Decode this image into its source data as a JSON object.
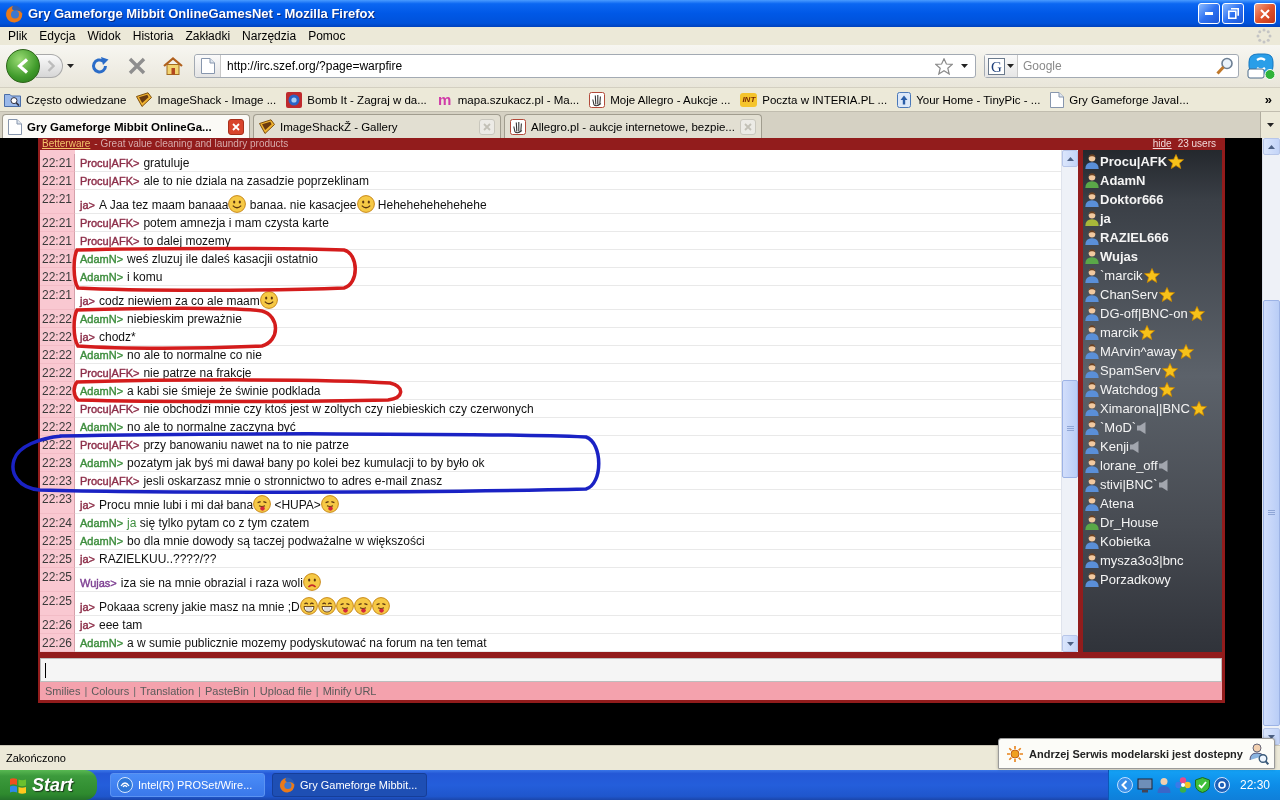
{
  "window": {
    "title": "Gry Gameforge Mibbit OnlineGamesNet - Mozilla Firefox"
  },
  "menu": [
    "Plik",
    "Edycja",
    "Widok",
    "Historia",
    "Zakładki",
    "Narzędzia",
    "Pomoc"
  ],
  "navigation": {
    "url": "http://irc.szef.org/?page=warpfire",
    "search_engine": "G",
    "search_placeholder": "Google"
  },
  "bookmarks": {
    "items": [
      {
        "kind": "folder",
        "label": "Często odwiedzane"
      },
      {
        "kind": "wedge",
        "label": "ImageShack - Image ..."
      },
      {
        "kind": "target",
        "label": "Bomb It - Zagraj w da..."
      },
      {
        "kind": "letter",
        "badge": "m",
        "label": "mapa.szukacz.pl - Ma..."
      },
      {
        "kind": "hand",
        "label": "Moje Allegro - Aukcje ..."
      },
      {
        "kind": "tag",
        "badge": "INT",
        "label": "Poczta w INTERIA.PL ..."
      },
      {
        "kind": "card",
        "label": "Your Home - TinyPic - ..."
      },
      {
        "kind": "page",
        "label": "Gry Gameforge JavaI..."
      }
    ],
    "overflow": "»"
  },
  "tabs": [
    {
      "kind": "page",
      "label": "Gry Gameforge Mibbit OnlineGa...",
      "selected": true
    },
    {
      "kind": "wedge",
      "label": "ImageShackŽ - Gallery",
      "selected": false
    },
    {
      "kind": "hand",
      "label": "Allegro.pl - aukcje internetowe, bezpie...",
      "selected": false
    }
  ],
  "chat": {
    "ad": {
      "link": "Betterware",
      "text": "- Great value cleaning and laundry products"
    },
    "hide_link": "hide",
    "user_count": "23 users",
    "messages": [
      {
        "time": "22:21",
        "nick": "Procu|AFK>",
        "color": "#8c2d48",
        "parts": [
          {
            "kind": "text",
            "text": "gratuluje"
          }
        ]
      },
      {
        "time": "22:21",
        "nick": "Procu|AFK>",
        "color": "#8c2d48",
        "parts": [
          {
            "kind": "text",
            "text": "ale to nie dziala na zasadzie poprzeklinam"
          }
        ]
      },
      {
        "time": "22:21",
        "nick": "ja>",
        "color": "#8c2d48",
        "parts": [
          {
            "kind": "text",
            "text": "A Jaa tez maam banaaa"
          },
          {
            "kind": "smile"
          },
          {
            "kind": "text",
            "text": " banaa. nie kasacjee"
          },
          {
            "kind": "smile"
          },
          {
            "kind": "text",
            "text": " Hehehehehehehehe"
          }
        ]
      },
      {
        "time": "22:21",
        "nick": "Procu|AFK>",
        "color": "#8c2d48",
        "parts": [
          {
            "kind": "text",
            "text": "potem amnezja i mam czysta karte"
          }
        ]
      },
      {
        "time": "22:21",
        "nick": "Procu|AFK>",
        "color": "#8c2d48",
        "parts": [
          {
            "kind": "text",
            "text": "to dalej mozemy"
          }
        ]
      },
      {
        "time": "22:21",
        "nick": "AdamN>",
        "color": "#3e8e3e",
        "parts": [
          {
            "kind": "text",
            "text": "weś zluzuj ile daleś kasacjii ostatnio"
          }
        ]
      },
      {
        "time": "22:21",
        "nick": "AdamN>",
        "color": "#3e8e3e",
        "parts": [
          {
            "kind": "text",
            "text": "i komu"
          }
        ]
      },
      {
        "time": "22:21",
        "nick": "ja>",
        "color": "#8c2d48",
        "parts": [
          {
            "kind": "text",
            "text": "codz niewiem za co ale maam"
          },
          {
            "kind": "smile"
          }
        ]
      },
      {
        "time": "22:22",
        "nick": "AdamN>",
        "color": "#3e8e3e",
        "parts": [
          {
            "kind": "text",
            "text": "niebieskim preważnie"
          }
        ]
      },
      {
        "time": "22:22",
        "nick": "ja>",
        "color": "#8c2d48",
        "parts": [
          {
            "kind": "text",
            "text": "chodz*"
          }
        ]
      },
      {
        "time": "22:22",
        "nick": "AdamN>",
        "color": "#3e8e3e",
        "parts": [
          {
            "kind": "text",
            "text": "no ale to normalne co nie"
          }
        ]
      },
      {
        "time": "22:22",
        "nick": "Procu|AFK>",
        "color": "#8c2d48",
        "parts": [
          {
            "kind": "text",
            "text": "nie patrze na frakcje"
          }
        ]
      },
      {
        "time": "22:22",
        "nick": "AdamN>",
        "color": "#3e8e3e",
        "parts": [
          {
            "kind": "text",
            "text": "a kabi sie śmieje że świnie podklada"
          }
        ]
      },
      {
        "time": "22:22",
        "nick": "Procu|AFK>",
        "color": "#8c2d48",
        "parts": [
          {
            "kind": "text",
            "text": "nie obchodzi mnie czy ktoś jest w zoltych czy niebieskich czy czerwonych"
          }
        ]
      },
      {
        "time": "22:22",
        "nick": "AdamN>",
        "color": "#3e8e3e",
        "parts": [
          {
            "kind": "text",
            "text": "no ale to normalne zaczyna być"
          }
        ]
      },
      {
        "time": "22:22",
        "nick": "Procu|AFK>",
        "color": "#8c2d48",
        "parts": [
          {
            "kind": "text",
            "text": "przy banowaniu nawet na to nie patrze"
          }
        ]
      },
      {
        "time": "22:23",
        "nick": "AdamN>",
        "color": "#3e8e3e",
        "parts": [
          {
            "kind": "text",
            "text": "pozatym jak byś mi dawał bany po kolei bez kumulacji to by było ok"
          }
        ]
      },
      {
        "time": "22:23",
        "nick": "Procu|AFK>",
        "color": "#8c2d48",
        "parts": [
          {
            "kind": "text",
            "text": "jesli oskarzasz mnie o stronnictwo to adres e-mail znasz"
          }
        ]
      },
      {
        "time": "22:23",
        "nick": "ja>",
        "color": "#8c2d48",
        "parts": [
          {
            "kind": "text",
            "text": "Procu mnie lubi i mi dał bana"
          },
          {
            "kind": "tongue"
          },
          {
            "kind": "text",
            "text": " <HUPA>"
          },
          {
            "kind": "tongue"
          }
        ]
      },
      {
        "time": "22:24",
        "nick": "AdamN>",
        "color": "#3e8e3e",
        "parts": [
          {
            "kind": "mention",
            "text": "ja"
          },
          {
            "kind": "text",
            "text": " się tylko pytam co z tym czatem"
          }
        ]
      },
      {
        "time": "22:25",
        "nick": "AdamN>",
        "color": "#3e8e3e",
        "parts": [
          {
            "kind": "text",
            "text": "bo dla mnie dowody są taczej podważalne w większości"
          }
        ]
      },
      {
        "time": "22:25",
        "nick": "ja>",
        "color": "#8c2d48",
        "parts": [
          {
            "kind": "text",
            "text": "RAZIELKUU..????/??"
          }
        ]
      },
      {
        "time": "22:25",
        "nick": "Wujas>",
        "color": "#7d3f92",
        "parts": [
          {
            "kind": "text",
            "text": "iza sie na mnie obrazial i raza woli"
          },
          {
            "kind": "sad"
          }
        ]
      },
      {
        "time": "22:25",
        "nick": "ja>",
        "color": "#8c2d48",
        "parts": [
          {
            "kind": "text",
            "text": "Pokaaa screny jakie masz na mnie ;D"
          },
          {
            "kind": "grin"
          },
          {
            "kind": "grin"
          },
          {
            "kind": "tongue"
          },
          {
            "kind": "tongue"
          },
          {
            "kind": "tongue"
          }
        ]
      },
      {
        "time": "22:26",
        "nick": "ja>",
        "color": "#8c2d48",
        "parts": [
          {
            "kind": "text",
            "text": "eee tam"
          }
        ]
      },
      {
        "time": "22:26",
        "nick": "AdamN>",
        "color": "#3e8e3e",
        "parts": [
          {
            "kind": "text",
            "text": "a w sumie publicznie mozemy podyskutować na forum na ten temat"
          }
        ]
      }
    ],
    "links": [
      {
        "label": "Smilies"
      },
      {
        "label": "Colours"
      },
      {
        "label": "Translation"
      },
      {
        "label": "PasteBin"
      },
      {
        "label": "Upload file"
      },
      {
        "label": "Minify URL"
      }
    ],
    "separator": "|"
  },
  "users": [
    {
      "name": "Procu|AFK",
      "kind": "op",
      "highlighted": true,
      "color": "#5a8fd8"
    },
    {
      "name": "AdamN",
      "kind": "regular",
      "highlighted": true,
      "color": "#5aa848"
    },
    {
      "name": "Doktor666",
      "kind": "regular",
      "highlighted": true,
      "color": "#5a8fd8"
    },
    {
      "name": "ja",
      "kind": "regular",
      "highlighted": true,
      "color": "#a8b83a"
    },
    {
      "name": "RAZIEL666",
      "kind": "regular",
      "highlighted": true,
      "color": "#5a8fd8"
    },
    {
      "name": "Wujas",
      "kind": "regular",
      "highlighted": true,
      "color": "#5aa848"
    },
    {
      "name": "`marcik",
      "kind": "op",
      "highlighted": false,
      "color": "#5a8fd8"
    },
    {
      "name": "ChanServ",
      "kind": "op",
      "highlighted": false,
      "color": "#5a8fd8"
    },
    {
      "name": "DG-off|BNC-on",
      "kind": "op",
      "highlighted": false,
      "color": "#5a8fd8"
    },
    {
      "name": "marcik",
      "kind": "op",
      "highlighted": false,
      "color": "#5a8fd8"
    },
    {
      "name": "MArvin^away",
      "kind": "op",
      "highlighted": false,
      "color": "#5a8fd8"
    },
    {
      "name": "SpamServ",
      "kind": "op",
      "highlighted": false,
      "color": "#5a8fd8"
    },
    {
      "name": "Watchdog",
      "kind": "op",
      "highlighted": false,
      "color": "#5a8fd8"
    },
    {
      "name": "Ximarona||BNC",
      "kind": "op",
      "highlighted": false,
      "color": "#5a8fd8"
    },
    {
      "name": "`MoD`",
      "kind": "voice",
      "highlighted": false,
      "color": "#5a8fd8"
    },
    {
      "name": "Kenji",
      "kind": "voice",
      "highlighted": false,
      "color": "#5a8fd8"
    },
    {
      "name": "lorane_off",
      "kind": "voice",
      "highlighted": false,
      "color": "#5a8fd8"
    },
    {
      "name": "stivi|BNC`",
      "kind": "voice",
      "highlighted": false,
      "color": "#5a8fd8"
    },
    {
      "name": "Atena",
      "kind": "regular",
      "highlighted": false,
      "color": "#5a8fd8"
    },
    {
      "name": "Dr_House",
      "kind": "regular",
      "highlighted": false,
      "color": "#5aa848"
    },
    {
      "name": "Kobietka",
      "kind": "regular",
      "highlighted": false,
      "color": "#5a8fd8"
    },
    {
      "name": "mysza3o3|bnc",
      "kind": "regular",
      "highlighted": false,
      "color": "#5a8fd8"
    },
    {
      "name": "Porzadkowy",
      "kind": "regular",
      "highlighted": false,
      "color": "#5a8fd8"
    }
  ],
  "annotations": [
    {
      "kind": "loop",
      "color": "#d41c1c"
    },
    {
      "kind": "loop",
      "color": "#d41c1c"
    },
    {
      "kind": "loop",
      "color": "#d41c1c"
    },
    {
      "kind": "loop",
      "color": "#1a22c4"
    }
  ],
  "status_bar": {
    "text": "Zakończono"
  },
  "notification": {
    "text": "Andrzej Serwis modelarski jest dostepny"
  },
  "taskbar": {
    "start": "Start",
    "tasks": [
      {
        "kind": "network",
        "label": "Intel(R) PROSet/Wire...",
        "selected": false
      },
      {
        "kind": "globe",
        "label": "Gry Gameforge Mibbit...",
        "selected": true
      }
    ],
    "clock": "22:30"
  }
}
